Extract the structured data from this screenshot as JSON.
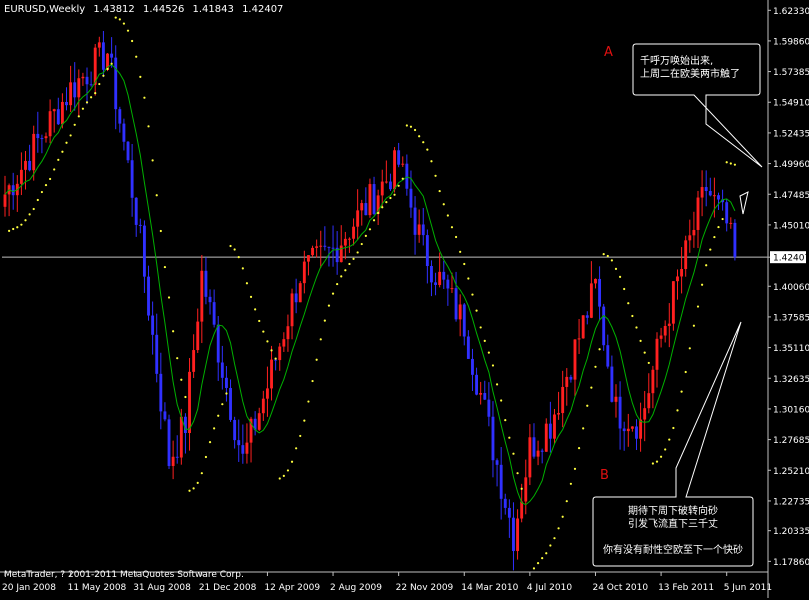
{
  "header": {
    "symbol": "EURUSD,Weekly",
    "open": "1.43812",
    "high": "1.44526",
    "low": "1.41843",
    "close": "1.42407"
  },
  "copyright": "MetaTrader, ? 2001-2011 MetaQuotes Software Corp.",
  "labels": {
    "a": "A",
    "b": "B"
  },
  "callout_a": "千呼万唤始出来,\n上周二在欧美两市触了",
  "callout_b": "期待下周下破转向砂\n引发飞流直下三千丈\n\n你有没有耐性空欧至下一个快砂",
  "colors": {
    "background": "#000000",
    "bull_candle": "#ff2020",
    "bear_candle": "#3030ff",
    "moving_average": "#00b000",
    "parabolic_sar": "#ffff40",
    "price_line": "#c0c0c0",
    "axis": "#c0c0c0",
    "label_text": "#e01010"
  },
  "chart_data": {
    "type": "candlestick",
    "current_price": 1.42407,
    "ylim": [
      1.17,
      1.63
    ],
    "y_ticks": [
      "1.62330",
      "1.59860",
      "1.57385",
      "1.54910",
      "1.52435",
      "1.49960",
      "1.47485",
      "1.45010",
      "1.42407",
      "1.40060",
      "1.37585",
      "1.35110",
      "1.32635",
      "1.30160",
      "1.27685",
      "1.25210",
      "1.22735",
      "1.20335",
      "1.17860"
    ],
    "x_ticks": [
      "20 Jan 2008",
      "11 May 2008",
      "31 Aug 2008",
      "21 Dec 2008",
      "12 Apr 2009",
      "2 Aug 2009",
      "22 Nov 2009",
      "14 Mar 2010",
      "4 Jul 2010",
      "24 Oct 2010",
      "13 Feb 2011",
      "5 Jun 2011"
    ],
    "anchors": [
      {
        "x": "20 Jan 2008",
        "close": 1.475
      },
      {
        "x": "11 May 2008",
        "close": 1.56
      },
      {
        "x": "13 Jul 2008",
        "close": 1.59
      },
      {
        "x": "31 Aug 2008",
        "close": 1.46
      },
      {
        "x": "26 Oct 2008",
        "close": 1.26
      },
      {
        "x": "23 Nov 2008",
        "close": 1.29
      },
      {
        "x": "21 Dec 2008",
        "close": 1.41
      },
      {
        "x": "1 Mar 2009",
        "close": 1.26
      },
      {
        "x": "12 Apr 2009",
        "close": 1.32
      },
      {
        "x": "7 Jun 2009",
        "close": 1.41
      },
      {
        "x": "2 Aug 2009",
        "close": 1.43
      },
      {
        "x": "22 Nov 2009",
        "close": 1.5
      },
      {
        "x": "3 Jan 2010",
        "close": 1.43
      },
      {
        "x": "14 Mar 2010",
        "close": 1.37
      },
      {
        "x": "6 Jun 2010",
        "close": 1.2
      },
      {
        "x": "4 Jul 2010",
        "close": 1.27
      },
      {
        "x": "8 Aug 2010",
        "close": 1.29
      },
      {
        "x": "24 Oct 2010",
        "close": 1.4
      },
      {
        "x": "28 Nov 2010",
        "close": 1.3
      },
      {
        "x": "9 Jan 2011",
        "close": 1.29
      },
      {
        "x": "13 Feb 2011",
        "close": 1.36
      },
      {
        "x": "1 May 2011",
        "close": 1.48
      },
      {
        "x": "5 Jun 2011",
        "close": 1.45
      },
      {
        "x": "19 Jun 2011",
        "close": 1.42407
      }
    ],
    "indicators": [
      "moving average",
      "parabolic SAR"
    ]
  }
}
